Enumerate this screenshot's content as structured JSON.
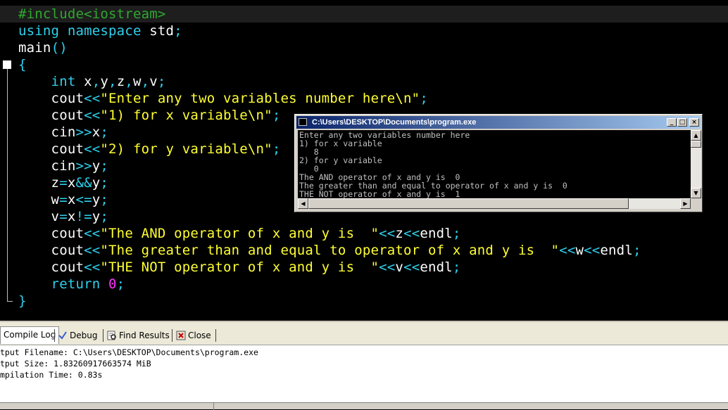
{
  "editor": {
    "lines": [
      [
        {
          "t": "#include<iostream>",
          "c": "pp"
        }
      ],
      [
        {
          "t": "using ",
          "c": "kw"
        },
        {
          "t": "namespace ",
          "c": "kw"
        },
        {
          "t": "std",
          "c": "plain"
        },
        {
          "t": ";",
          "c": "sym"
        }
      ],
      [
        {
          "t": "main",
          "c": "plain"
        },
        {
          "t": "()",
          "c": "sym"
        }
      ],
      [
        {
          "t": "{",
          "c": "sym"
        }
      ],
      [
        {
          "t": "    int ",
          "c": "tp"
        },
        {
          "t": "x",
          "c": "plain"
        },
        {
          "t": ",",
          "c": "sym"
        },
        {
          "t": "y",
          "c": "plain"
        },
        {
          "t": ",",
          "c": "sym"
        },
        {
          "t": "z",
          "c": "plain"
        },
        {
          "t": ",",
          "c": "sym"
        },
        {
          "t": "w",
          "c": "plain"
        },
        {
          "t": ",",
          "c": "sym"
        },
        {
          "t": "v",
          "c": "plain"
        },
        {
          "t": ";",
          "c": "sym"
        }
      ],
      [
        {
          "t": "    cout",
          "c": "plain"
        },
        {
          "t": "<<",
          "c": "sym"
        },
        {
          "t": "\"Enter any two variables number here\\n\"",
          "c": "str"
        },
        {
          "t": ";",
          "c": "sym"
        }
      ],
      [
        {
          "t": "    cout",
          "c": "plain"
        },
        {
          "t": "<<",
          "c": "sym"
        },
        {
          "t": "\"1) for x variable\\n\"",
          "c": "str"
        },
        {
          "t": ";",
          "c": "sym"
        }
      ],
      [
        {
          "t": "    cin",
          "c": "plain"
        },
        {
          "t": ">>",
          "c": "sym"
        },
        {
          "t": "x",
          "c": "plain"
        },
        {
          "t": ";",
          "c": "sym"
        }
      ],
      [
        {
          "t": "    cout",
          "c": "plain"
        },
        {
          "t": "<<",
          "c": "sym"
        },
        {
          "t": "\"2) for y variable\\n\"",
          "c": "str"
        },
        {
          "t": ";",
          "c": "sym"
        }
      ],
      [
        {
          "t": "    cin",
          "c": "plain"
        },
        {
          "t": ">>",
          "c": "sym"
        },
        {
          "t": "y",
          "c": "plain"
        },
        {
          "t": ";",
          "c": "sym"
        }
      ],
      [
        {
          "t": "    z",
          "c": "plain"
        },
        {
          "t": "=",
          "c": "sym"
        },
        {
          "t": "x",
          "c": "plain"
        },
        {
          "t": "&&",
          "c": "sym"
        },
        {
          "t": "y",
          "c": "plain"
        },
        {
          "t": ";",
          "c": "sym"
        }
      ],
      [
        {
          "t": "    w",
          "c": "plain"
        },
        {
          "t": "=",
          "c": "sym"
        },
        {
          "t": "x",
          "c": "plain"
        },
        {
          "t": "<=",
          "c": "sym"
        },
        {
          "t": "y",
          "c": "plain"
        },
        {
          "t": ";",
          "c": "sym"
        }
      ],
      [
        {
          "t": "    v",
          "c": "plain"
        },
        {
          "t": "=",
          "c": "sym"
        },
        {
          "t": "x",
          "c": "plain"
        },
        {
          "t": "!=",
          "c": "sym"
        },
        {
          "t": "y",
          "c": "plain"
        },
        {
          "t": ";",
          "c": "sym"
        }
      ],
      [
        {
          "t": "    cout",
          "c": "plain"
        },
        {
          "t": "<<",
          "c": "sym"
        },
        {
          "t": "\"The AND operator of x and y is  \"",
          "c": "str"
        },
        {
          "t": "<<",
          "c": "sym"
        },
        {
          "t": "z",
          "c": "plain"
        },
        {
          "t": "<<",
          "c": "sym"
        },
        {
          "t": "endl",
          "c": "plain"
        },
        {
          "t": ";",
          "c": "sym"
        }
      ],
      [
        {
          "t": "    cout",
          "c": "plain"
        },
        {
          "t": "<<",
          "c": "sym"
        },
        {
          "t": "\"The greater than and equal to operator of x and y is  \"",
          "c": "str"
        },
        {
          "t": "<<",
          "c": "sym"
        },
        {
          "t": "w",
          "c": "plain"
        },
        {
          "t": "<<",
          "c": "sym"
        },
        {
          "t": "endl",
          "c": "plain"
        },
        {
          "t": ";",
          "c": "sym"
        }
      ],
      [
        {
          "t": "    cout",
          "c": "plain"
        },
        {
          "t": "<<",
          "c": "sym"
        },
        {
          "t": "\"THE NOT operator of x and y is  \"",
          "c": "str"
        },
        {
          "t": "<<",
          "c": "sym"
        },
        {
          "t": "v",
          "c": "plain"
        },
        {
          "t": "<<",
          "c": "sym"
        },
        {
          "t": "endl",
          "c": "plain"
        },
        {
          "t": ";",
          "c": "sym"
        }
      ],
      [
        {
          "t": "    return ",
          "c": "tp"
        },
        {
          "t": "0",
          "c": "num"
        },
        {
          "t": ";",
          "c": "sym"
        }
      ],
      [
        {
          "t": "}",
          "c": "sym"
        }
      ]
    ],
    "colors": {
      "preprocessor": "#2fa82f",
      "keyword": "#2ed1ee",
      "string": "#ffff33",
      "number": "#ff33ff",
      "text": "#ffffff",
      "background": "#000000"
    }
  },
  "console": {
    "title": "C:\\Users\\DESKTOP\\Documents\\program.exe",
    "buttons": {
      "minimize": "_",
      "maximize": "□",
      "close": "×"
    },
    "output": [
      "Enter any two variables number here",
      "1) for x variable",
      "   8",
      "2) for y variable",
      "   0",
      "The AND operator of x and y is  0",
      "The greater than and equal to operator of x and y is  0",
      "THE NOT operator of x and y is  1"
    ]
  },
  "tabs": [
    {
      "label": "Compile Log",
      "icon": "",
      "active": true
    },
    {
      "label": "Debug",
      "icon": "check-icon",
      "active": false
    },
    {
      "label": "Find Results",
      "icon": "find-icon",
      "active": false
    },
    {
      "label": "Close",
      "icon": "close-window-icon",
      "active": false
    }
  ],
  "log": {
    "lines": [
      "tput Filename: C:\\Users\\DESKTOP\\Documents\\program.exe",
      "tput Size: 1.83260917663574 MiB",
      "mpilation Time: 0.83s"
    ]
  }
}
